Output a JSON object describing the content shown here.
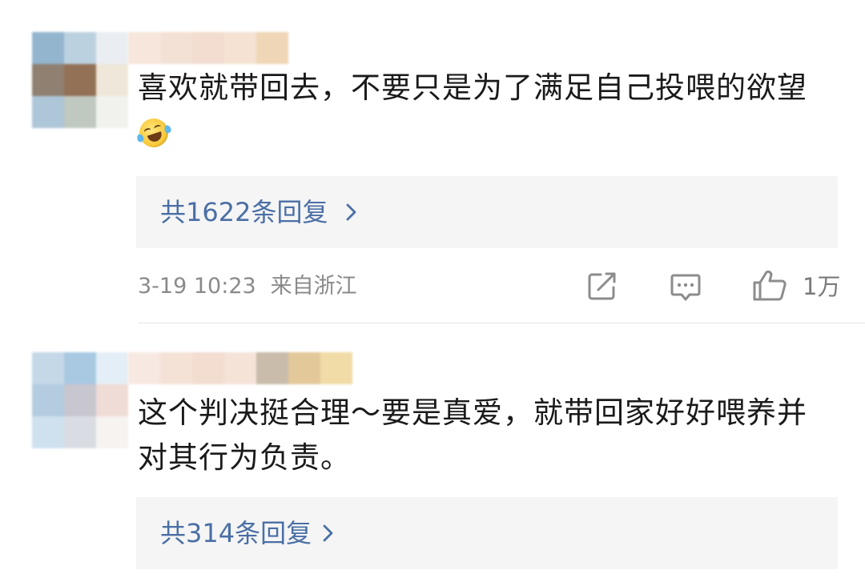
{
  "comments": [
    {
      "text": "喜欢就带回去，不要只是为了满足自己投喂的欲望",
      "emoji": "laughing-tears-emoji",
      "replies_label": "共1622条回复",
      "date": "3-19 10:23",
      "location": "来自浙江",
      "like_count": "1万"
    },
    {
      "text": "这个判决挺合理～要是真爱，就带回家好好喂养并对其行为负责。",
      "replies_label": "共314条回复"
    }
  ],
  "icons": {
    "share": "share-icon",
    "comment": "comment-icon",
    "like": "thumbs-up-icon",
    "chevron": "chevron-right-icon"
  },
  "colors": {
    "reply_link": "#4a6fa5",
    "reply_bg": "#f5f5f5",
    "meta_text": "#8a8a8a",
    "icon_gray": "#8c8c8c"
  }
}
